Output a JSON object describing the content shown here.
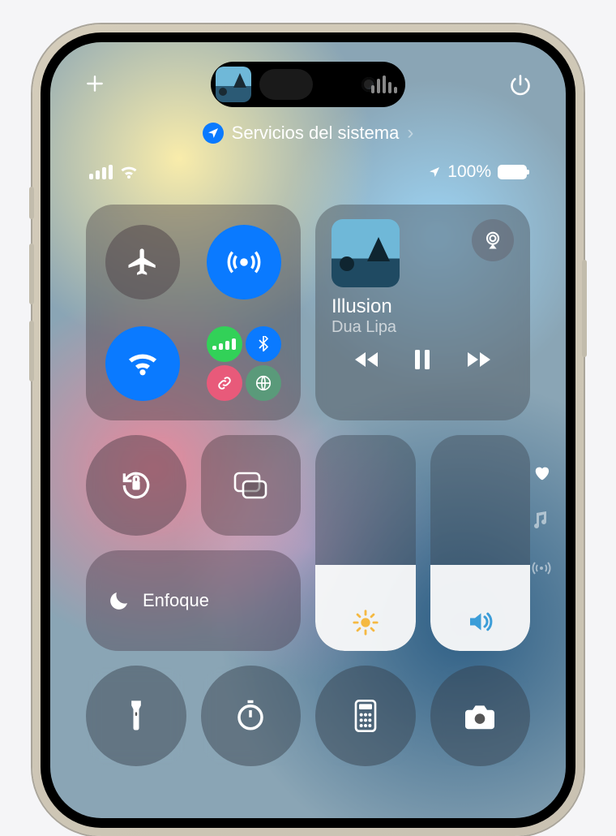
{
  "services": {
    "label": "Servicios del sistema"
  },
  "status": {
    "battery_pct": "100%"
  },
  "media": {
    "title": "Illusion",
    "artist": "Dua Lipa"
  },
  "focus": {
    "label": "Enfoque"
  },
  "sliders": {
    "brightness_pct": 40,
    "volume_pct": 40
  },
  "connectivity": {
    "airplane": false,
    "airdrop": true,
    "wifi": true,
    "cellular": true,
    "bluetooth": true
  }
}
